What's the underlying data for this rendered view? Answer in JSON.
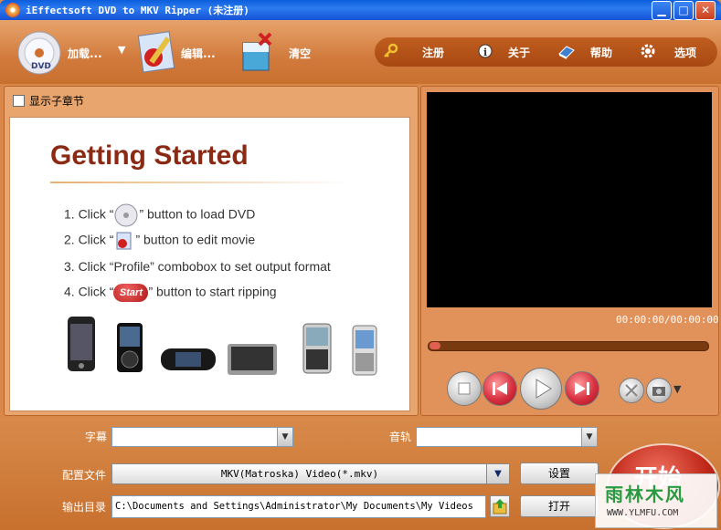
{
  "window": {
    "title": "iEffectsoft DVD to MKV Ripper (未注册)",
    "minimize_glyph": "▁",
    "maximize_glyph": "□",
    "close_glyph": "✕"
  },
  "toolbar": {
    "load_label": "加载...",
    "load_arrow": "▼",
    "edit_label": "编辑...",
    "clear_label": "清空",
    "register_label": "注册",
    "about_label": "关于",
    "help_label": "帮助",
    "options_label": "选项"
  },
  "left_panel": {
    "show_subchapter_label": "显示子章节",
    "getting_started_title": "Getting Started",
    "steps": [
      {
        "prefix": "1. Click “",
        "suffix": "” button to load DVD"
      },
      {
        "prefix": "2. Click “",
        "suffix": "” button to edit movie"
      },
      {
        "text": "3. Click “Profile” combobox to set output format"
      },
      {
        "prefix": "4. Click “",
        "suffix": "” button to start ripping"
      }
    ],
    "start_badge": "Start"
  },
  "player": {
    "timecode": "00:00:00/00:00:00",
    "more_arrow": "▼"
  },
  "bottom": {
    "subtitle_label": "字幕",
    "audio_label": "音轨",
    "profile_label": "配置文件",
    "profile_value": "MKV(Matroska) Video(*.mkv)",
    "settings_button": "设置",
    "output_label": "输出目录",
    "output_path": "C:\\Documents and Settings\\Administrator\\My Documents\\My Videos",
    "open_button": "打开",
    "start_button": "开始"
  },
  "watermark": {
    "text": "雨林木风",
    "url": "WWW.YLMFU.COM"
  },
  "icons": [
    "dvd-disc-icon",
    "edit-icon",
    "clear-icon",
    "key-icon",
    "info-icon",
    "help-book-icon",
    "gear-icon",
    "stop-icon",
    "prev-icon",
    "play-icon",
    "next-icon",
    "snapshot-icon",
    "camera-icon",
    "folder-up-icon"
  ]
}
